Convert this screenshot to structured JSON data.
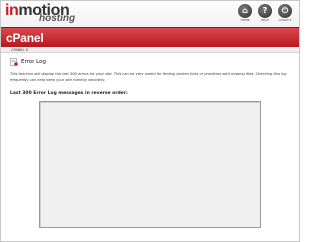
{
  "header": {
    "logo_prefix": "in",
    "logo_main": "motion",
    "logo_sub": "hosting",
    "tools": [
      {
        "icon": "home-icon",
        "glyph": "⌂",
        "label": "home"
      },
      {
        "icon": "help-icon",
        "glyph": "?",
        "label": "help"
      },
      {
        "icon": "logout-icon",
        "glyph": "⏻",
        "label": "logout"
      }
    ]
  },
  "cpanel_bar": {
    "title": "cPanel"
  },
  "breadcrumb": {
    "text": "CPANEL X"
  },
  "main": {
    "heading": "Error Log",
    "description": "This function will display the last 300 errors for your site. This can be very useful for finding broken links or problems with missing files. Checking this log frequently can help keep your site running smoothly.",
    "log_label": "Last 300 Error Log messages in reverse order:",
    "log_content": ""
  },
  "colors": {
    "brand_red": "#c62026",
    "bar_red": "#b8181f",
    "log_bg": "#f0f0f0"
  }
}
